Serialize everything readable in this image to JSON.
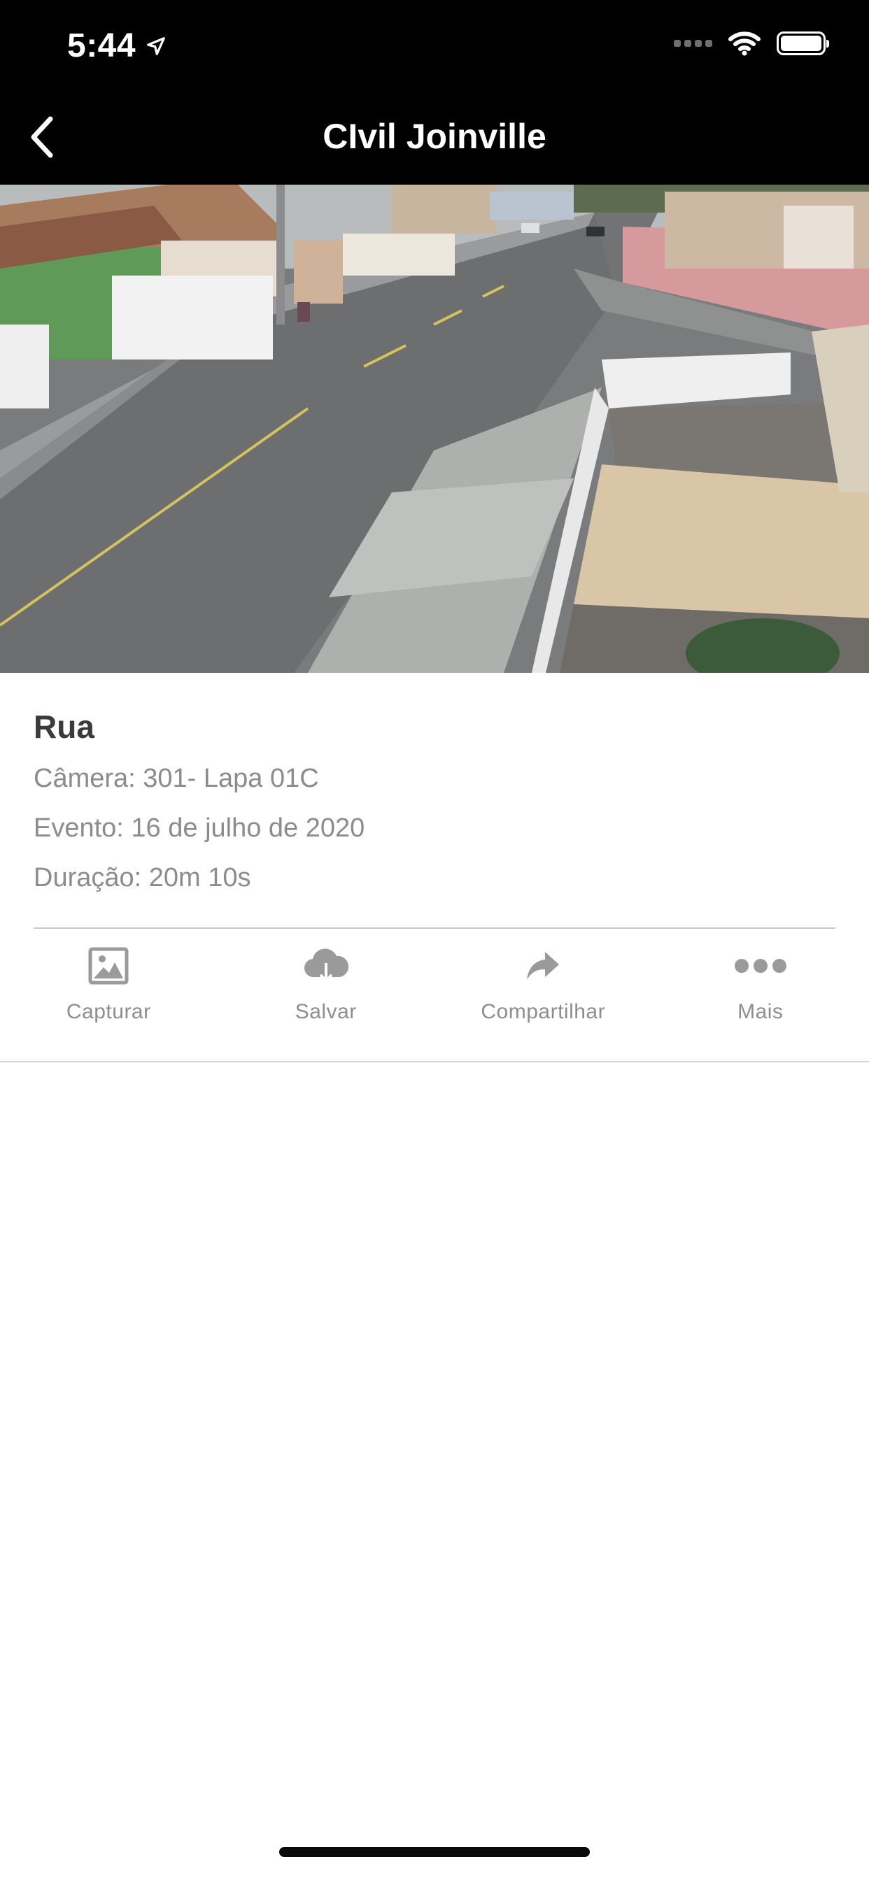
{
  "status_bar": {
    "time": "5:44"
  },
  "nav": {
    "title": "CIvil Joinville"
  },
  "event": {
    "title": "Rua",
    "camera": "Câmera: 301- Lapa 01C",
    "date": "Evento: 16 de julho de 2020",
    "duration": "Duração: 20m 10s"
  },
  "actions": [
    {
      "label": "Capturar",
      "icon": "image-icon"
    },
    {
      "label": "Salvar",
      "icon": "cloud-download-icon"
    },
    {
      "label": "Compartilhar",
      "icon": "share-arrow-icon"
    },
    {
      "label": "Mais",
      "icon": "more-dots-icon"
    }
  ],
  "colors": {
    "top_bar": "#000000",
    "icon_gray": "#9a9a9a",
    "label_gray": "#8e8e8e",
    "title_text": "#3b3b3b"
  }
}
